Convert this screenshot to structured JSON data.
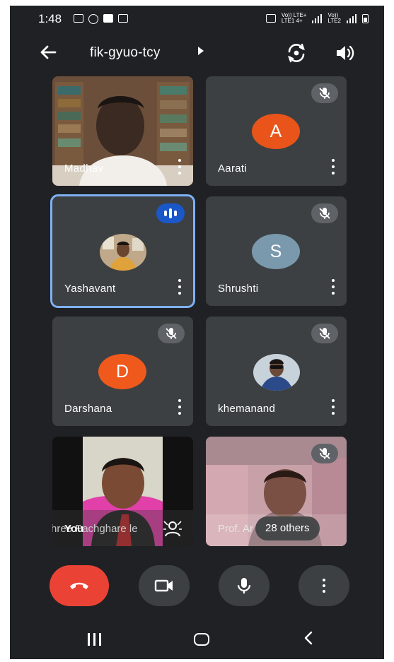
{
  "status_bar": {
    "time": "1:48",
    "net1": "Vo)) LTE+",
    "net1_sub": "LTE1 4+",
    "net2": "Vo))",
    "net2_sub": "LTE2"
  },
  "header": {
    "meeting_code": "fik-gyuo-tcy",
    "icons": [
      "back-arrow-icon",
      "chevron-right-icon",
      "camera-flip-icon",
      "speaker-icon"
    ]
  },
  "participants": [
    {
      "name": "Madhav",
      "muted": false,
      "video": true
    },
    {
      "name": "Aarati",
      "initial": "A",
      "avatar_color": "#e8541a",
      "muted": true
    },
    {
      "name": "Yashavant",
      "speaking": true
    },
    {
      "name": "Shrushti",
      "initial": "S",
      "avatar_color": "#7a99ac",
      "muted": true
    },
    {
      "name": "Darshana",
      "initial": "D",
      "avatar_color": "#f0591c",
      "muted": true
    },
    {
      "name": "khemanand",
      "muted": true
    }
  ],
  "self_tile": {
    "label": "You",
    "background_caption": "Shree Pachghare le"
  },
  "others_tile": {
    "name_partial": "Prof. Ar",
    "others_label": "28 others",
    "muted": true
  },
  "controls": {
    "end_call_color": "#ea4335",
    "icons": [
      "end-call-icon",
      "camera-icon",
      "microphone-icon",
      "more-options-icon"
    ]
  }
}
